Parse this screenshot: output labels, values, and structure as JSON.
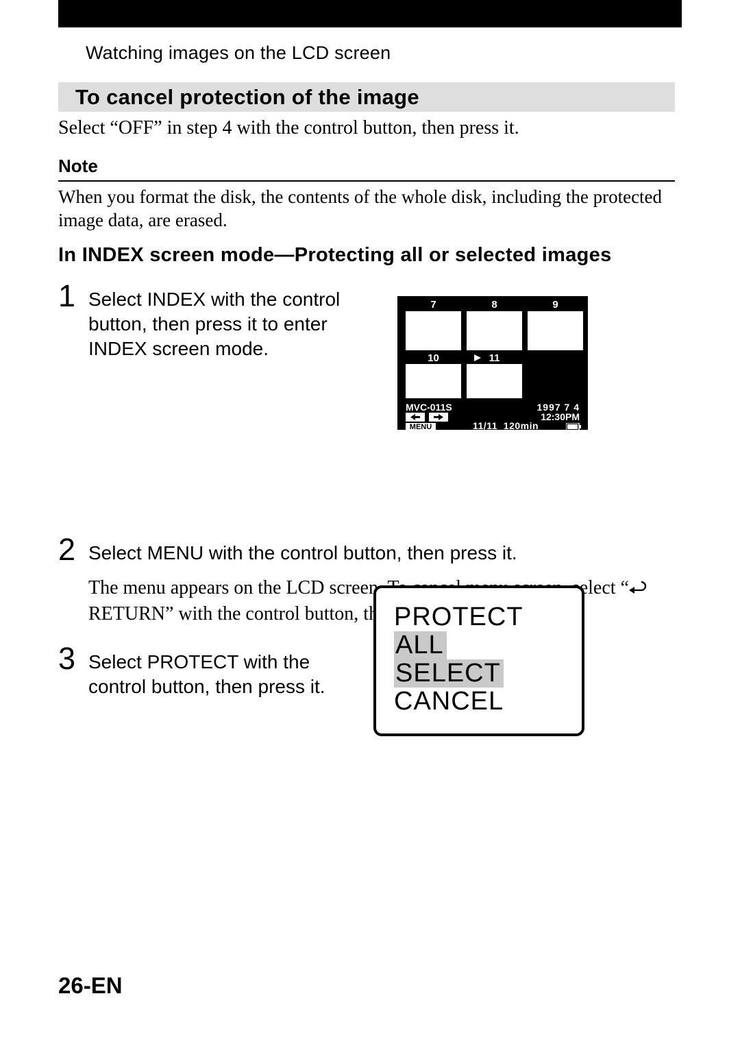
{
  "breadcrumb": "Watching images on the LCD screen",
  "section_bar_title": "To cancel protection of the image",
  "section_bar_body": "Select “OFF” in step 4 with the control button, then press it.",
  "note": {
    "title": "Note",
    "body": "When you format the disk, the contents of the whole disk, including the protected image data, are erased."
  },
  "mode_heading": "In INDEX screen mode—Protecting all or selected images",
  "steps": [
    {
      "num": "1",
      "text": "Select  INDEX  with the control button, then press it to enter INDEX screen mode."
    },
    {
      "num": "2",
      "text": "Select  MENU  with the control button, then press it.",
      "note_before": "The menu appears on the LCD screen. To cancel menu screen, select “",
      "note_after": "RETURN” with the control button, then press it."
    },
    {
      "num": "3",
      "text": "Select  PROTECT  with the control button, then press it."
    }
  ],
  "index_figure": {
    "thumb_numbers": [
      "7",
      "8",
      "9",
      "10",
      "11"
    ],
    "cursor_on": "11",
    "model": "MVC-011S",
    "date": "1997  7  4",
    "time": "12:30PM",
    "counter": "11/11",
    "remaining": "120min",
    "menu_label": "MENU"
  },
  "protect_figure": {
    "title": "PROTECT",
    "opt1": "ALL",
    "opt2": "SELECT",
    "opt3": "CANCEL"
  },
  "page_number": "26-EN"
}
